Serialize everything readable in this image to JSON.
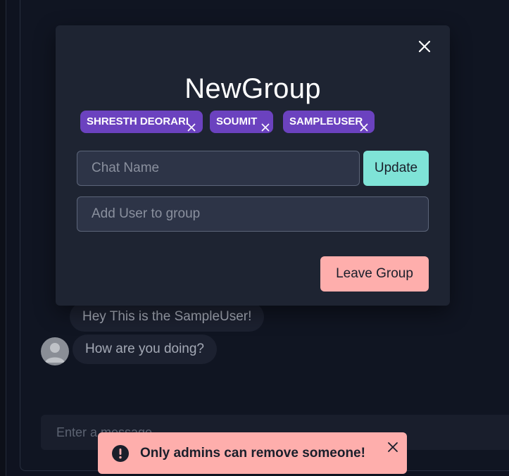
{
  "colors": {
    "page_bg": "#0f1320",
    "modal_bg": "#1e2432",
    "chip_bg": "#6b42bf",
    "update_button": "#7fe3d7",
    "leave_button": "#feaeac",
    "toast_bg": "#feaeac"
  },
  "chat": {
    "messages": [
      {
        "text": "Hey This is the SampleUser!"
      },
      {
        "text": "How are you doing?"
      }
    ],
    "input_placeholder": "Enter a message.."
  },
  "modal": {
    "title": "NewGroup",
    "close_icon": "close-icon",
    "members": [
      {
        "name": "SHRESTH DEORARI"
      },
      {
        "name": "SOUMIT"
      },
      {
        "name": "SAMPLEUSER"
      }
    ],
    "chat_name": {
      "value": "",
      "placeholder": "Chat Name"
    },
    "update_label": "Update",
    "add_user": {
      "value": "",
      "placeholder": "Add User to group"
    },
    "leave_label": "Leave Group"
  },
  "toast": {
    "icon": "warning-circle-icon",
    "message": "Only admins can remove someone!",
    "close_icon": "close-icon"
  }
}
